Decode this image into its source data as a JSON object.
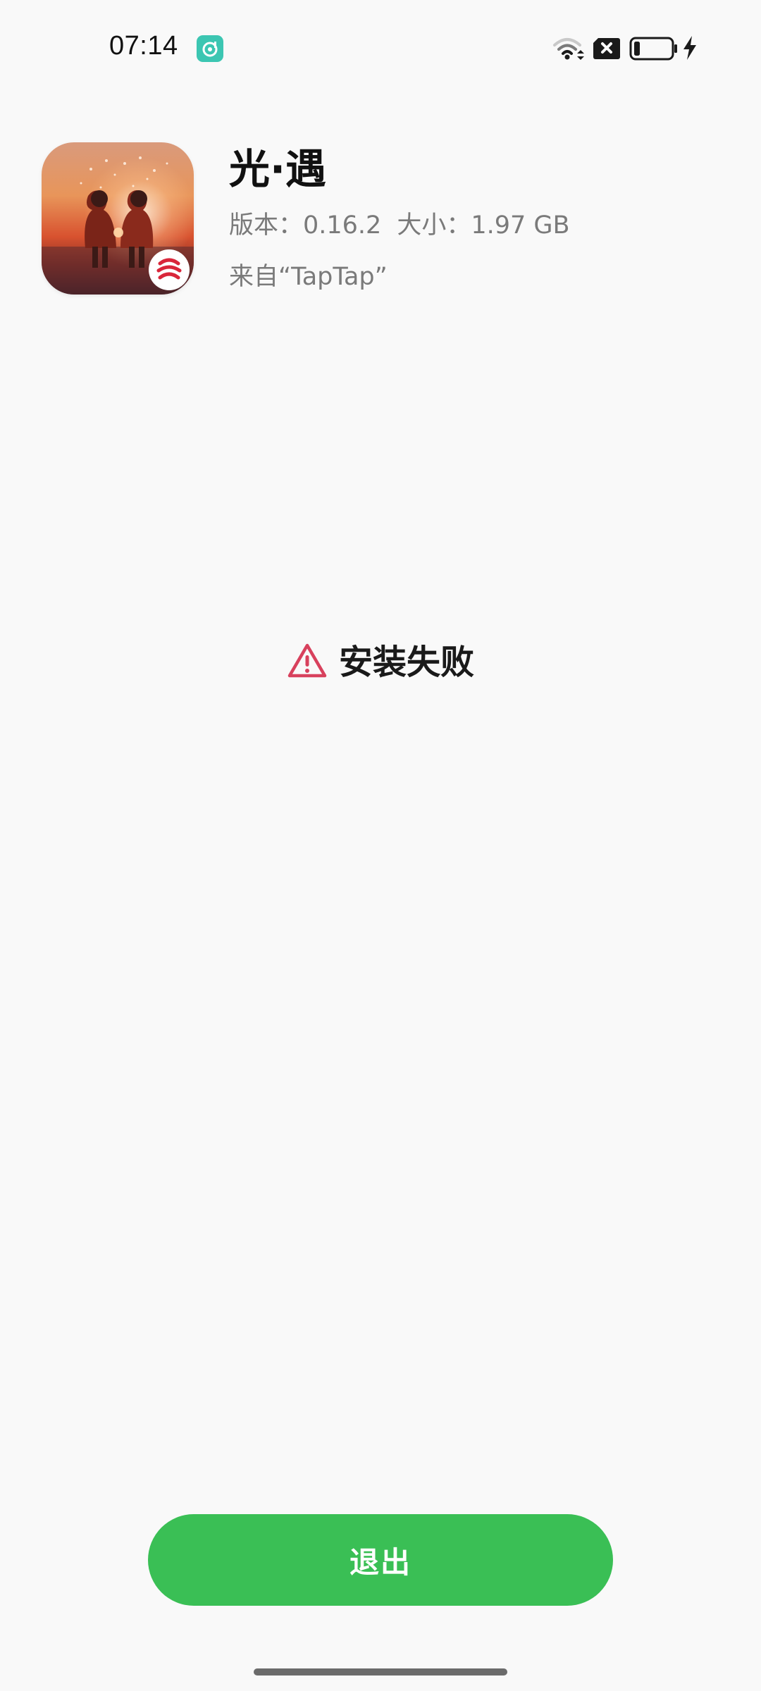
{
  "status_bar": {
    "time": "07:14",
    "icons": {
      "notification": "music-note-icon",
      "wifi": "wifi-icon",
      "sim": "no-sim-icon",
      "battery": "battery-low-icon",
      "charging": "charging-bolt-icon"
    },
    "battery_level": 0.12
  },
  "app": {
    "name": "光·遇",
    "version_text": "版本：0.16.2",
    "size_text": "大小：1.97 GB",
    "source_text": "来自“TapTap”",
    "icon": "app-icon-sky"
  },
  "result": {
    "icon": "warning-icon",
    "text": "安装失败",
    "icon_color": "#d8415d"
  },
  "actions": {
    "exit_label": "退出",
    "exit_color": "#3abf55"
  }
}
